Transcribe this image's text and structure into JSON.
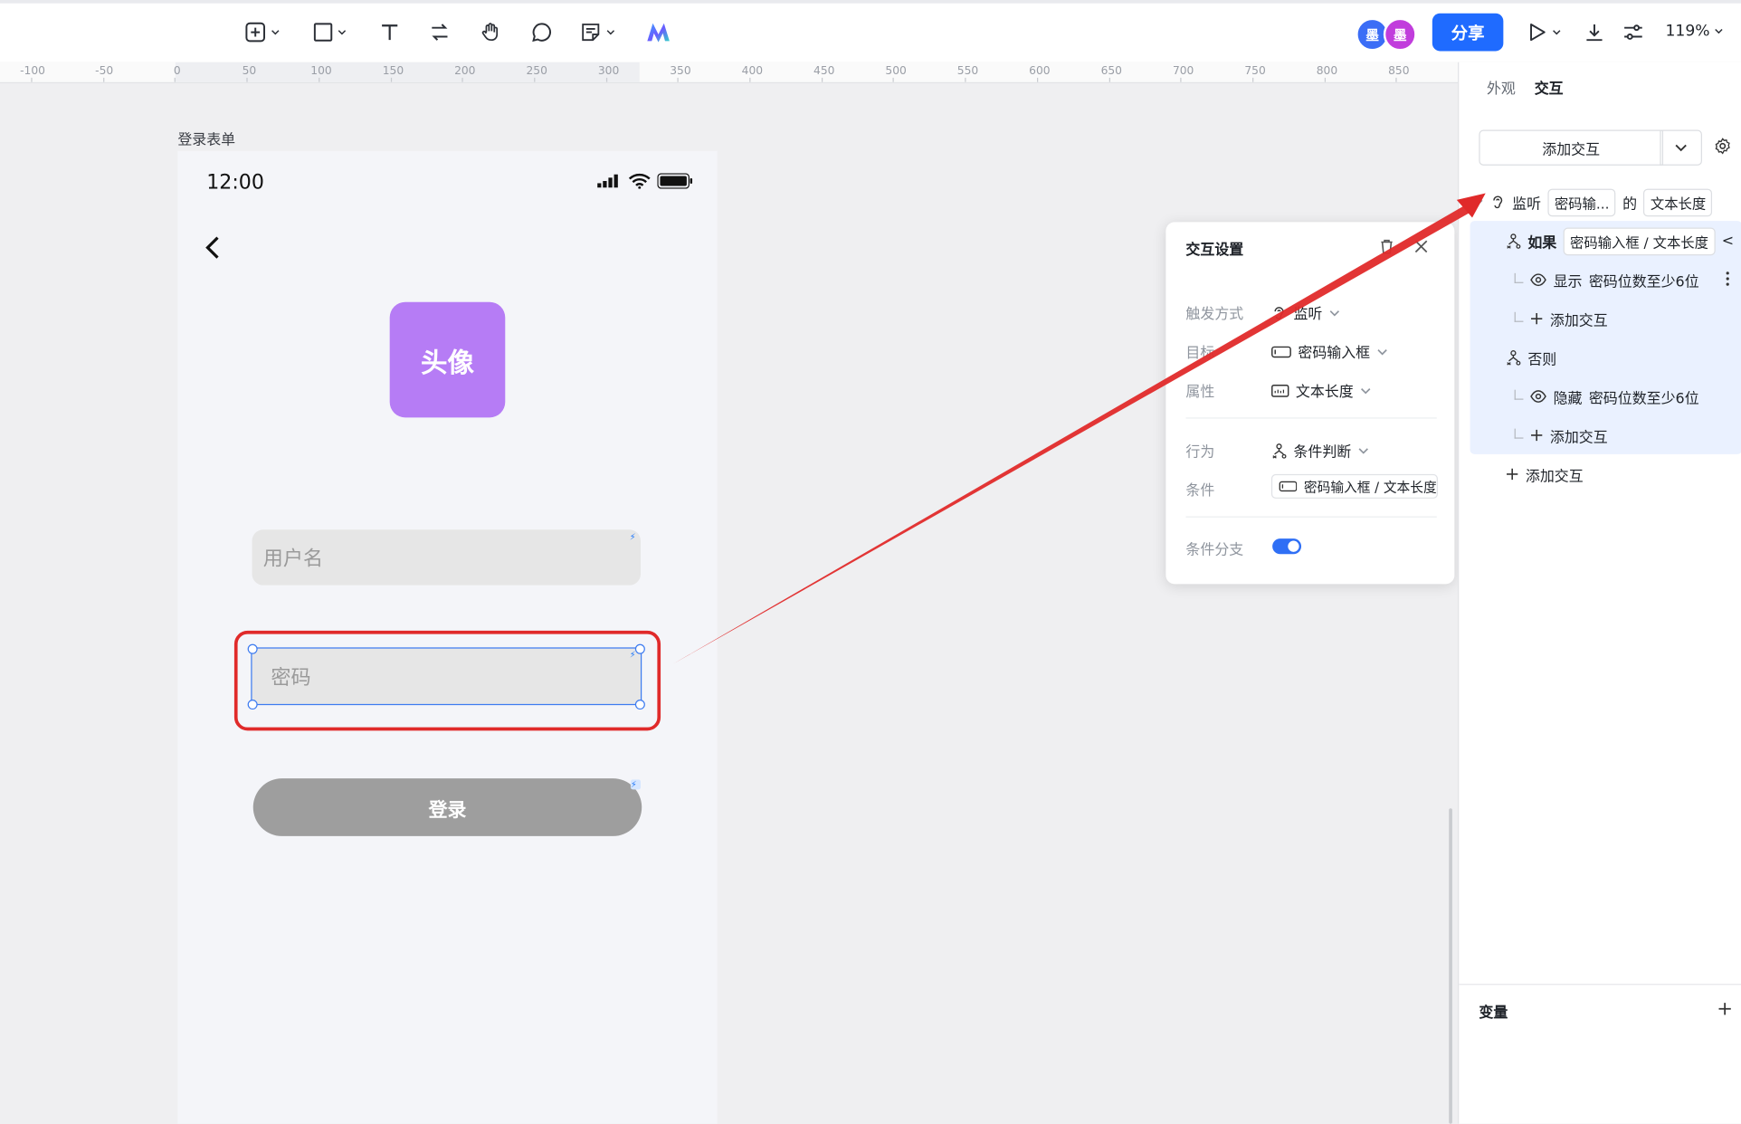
{
  "toolbar": {
    "avatar_1": "墨",
    "avatar_2": "墨",
    "share_label": "分享",
    "zoom_label": "119%"
  },
  "ruler": {
    "ticks": [
      "-100",
      "-50",
      "0",
      "50",
      "100",
      "150",
      "200",
      "250",
      "300",
      "350",
      "400",
      "450",
      "500",
      "550",
      "600",
      "650",
      "700",
      "750",
      "800",
      "850"
    ]
  },
  "canvas": {
    "frame_label": "登录表单"
  },
  "phone": {
    "clock": "12:00",
    "avatar_text": "头像",
    "username_placeholder": "用户名",
    "password_placeholder": "密码",
    "login_label": "登录"
  },
  "popup": {
    "title": "交互设置",
    "trigger_label": "触发方式",
    "trigger_value": "监听",
    "target_label": "目标",
    "target_value": "密码输入框",
    "property_label": "属性",
    "property_value": "文本长度",
    "behavior_label": "行为",
    "behavior_value": "条件判断",
    "condition_label": "条件",
    "condition_value": "密码输入框 / 文本长度",
    "branch_label": "条件分支",
    "branch_enabled": true
  },
  "right_panel": {
    "tab_appearance": "外观",
    "tab_interaction": "交互",
    "add_interaction_label": "添加交互",
    "listen_label": "监听",
    "listen_target": "密码输...",
    "of_label": "的",
    "listen_property": "文本长度",
    "if_label": "如果",
    "if_condition": "密码输入框 / 文本长度",
    "if_condition_op": "<",
    "show_action": "显示",
    "show_target": "密码位数至少6位",
    "add_inner_1": "添加交互",
    "else_label": "否则",
    "hide_action": "隐藏",
    "hide_target": "密码位数至少6位",
    "add_inner_2": "添加交互",
    "add_outer": "添加交互",
    "variables_label": "变量"
  },
  "colors": {
    "accent": "#1f6bff",
    "avatar_purple": "#b67cf5",
    "annotation_red": "#e02a2a",
    "selection_blue": "#3d7bf0"
  }
}
